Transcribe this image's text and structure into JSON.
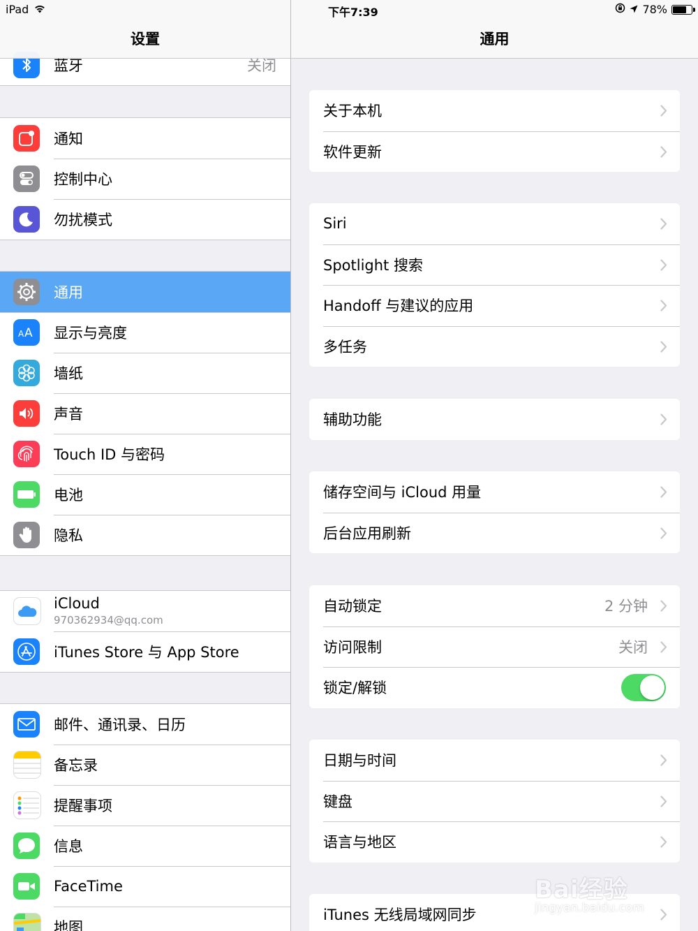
{
  "status_bar": {
    "device": "iPad",
    "time": "下午7:39",
    "battery": "78%",
    "battery_level": 0.78
  },
  "sidebar": {
    "title": "设置",
    "bluetooth": {
      "label": "蓝牙",
      "value": "关闭",
      "icon": "bluetooth-icon",
      "color": "#1a82fb"
    },
    "groups": [
      [
        {
          "label": "通知",
          "icon": "notifications-icon",
          "color": "#fc3d39"
        },
        {
          "label": "控制中心",
          "icon": "control-center-icon",
          "color": "#8e8e93"
        },
        {
          "label": "勿扰模式",
          "icon": "moon-icon",
          "color": "#5856d6"
        }
      ],
      [
        {
          "label": "通用",
          "icon": "gear-icon",
          "color": "#8e8e93",
          "selected": true
        },
        {
          "label": "显示与亮度",
          "icon": "display-icon",
          "color": "#1a82fb"
        },
        {
          "label": "墙纸",
          "icon": "wallpaper-icon",
          "color": "#34aadc"
        },
        {
          "label": "声音",
          "icon": "sound-icon",
          "color": "#fc3d39"
        },
        {
          "label": "Touch ID 与密码",
          "icon": "fingerprint-icon",
          "color": "#fc3d58"
        },
        {
          "label": "电池",
          "icon": "battery-icon",
          "color": "#4cd964"
        },
        {
          "label": "隐私",
          "icon": "hand-icon",
          "color": "#8e8e93"
        }
      ],
      [
        {
          "label": "iCloud",
          "sublabel": "970362934@qq.com",
          "icon": "icloud-icon",
          "color": "#ffffff"
        },
        {
          "label": "iTunes Store 与 App Store",
          "icon": "app-store-icon",
          "color": "#1a82fb"
        }
      ],
      [
        {
          "label": "邮件、通讯录、日历",
          "icon": "mail-icon",
          "color": "#1a82fb"
        },
        {
          "label": "备忘录",
          "icon": "notes-icon",
          "color": "#ffcc00"
        },
        {
          "label": "提醒事项",
          "icon": "reminders-icon",
          "color": "#ffffff"
        },
        {
          "label": "信息",
          "icon": "messages-icon",
          "color": "#4cd964"
        },
        {
          "label": "FaceTime",
          "icon": "facetime-icon",
          "color": "#4cd964"
        },
        {
          "label": "地图",
          "icon": "maps-icon",
          "color": "#e8f0e0"
        }
      ]
    ]
  },
  "detail": {
    "title": "通用",
    "groups": [
      [
        {
          "label": "关于本机"
        },
        {
          "label": "软件更新"
        }
      ],
      [
        {
          "label": "Siri"
        },
        {
          "label": "Spotlight 搜索"
        },
        {
          "label": "Handoff 与建议的应用"
        },
        {
          "label": "多任务"
        }
      ],
      [
        {
          "label": "辅助功能"
        }
      ],
      [
        {
          "label": "储存空间与 iCloud 用量"
        },
        {
          "label": "后台应用刷新"
        }
      ],
      [
        {
          "label": "自动锁定",
          "value": "2 分钟"
        },
        {
          "label": "访问限制",
          "value": "关闭"
        },
        {
          "label": "锁定/解锁",
          "toggle": true
        }
      ],
      [
        {
          "label": "日期与时间"
        },
        {
          "label": "键盘"
        },
        {
          "label": "语言与地区"
        }
      ],
      [
        {
          "label": "iTunes 无线局域网同步"
        }
      ]
    ]
  },
  "watermark": {
    "line1": "Bai经验",
    "line2": "jingyan.baidu.com"
  }
}
